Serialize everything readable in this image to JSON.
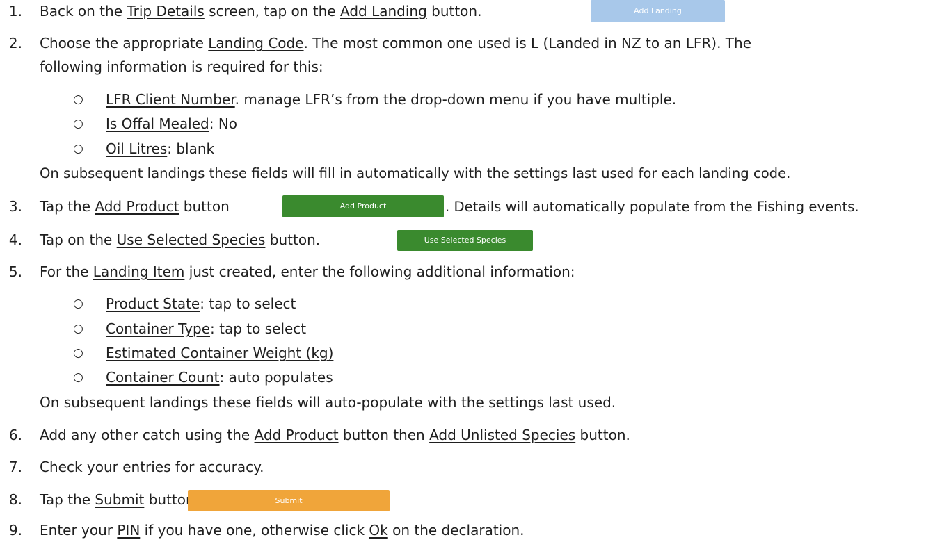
{
  "steps": [
    {
      "num": "1.",
      "parts": [
        "Back on the ",
        "Trip Details",
        " screen, tap on the ",
        "Add Landing",
        " button."
      ]
    },
    {
      "num": "2.",
      "parts": [
        "Choose the appropriate ",
        "Landing Code",
        ". The most common one used is L (Landed in NZ to an LFR). The"
      ],
      "cont": "following information is required for this:",
      "subitems": [
        {
          "link": "LFR Client Number",
          "rest": ". manage LFR’s from the drop-down menu if you have multiple."
        },
        {
          "link": "Is Offal Mealed",
          "rest": ": No"
        },
        {
          "link": "Oil Litres",
          "rest": ": blank"
        }
      ],
      "note": "On subsequent landings these fields will fill in automatically with the settings last used for each landing code."
    },
    {
      "num": "3.",
      "parts": [
        "Tap the ",
        "Add Product",
        " button",
        ". Details will automatically populate from the Fishing events."
      ]
    },
    {
      "num": "4.",
      "parts": [
        "Tap on the ",
        "Use Selected Species",
        " button."
      ]
    },
    {
      "num": "5.",
      "parts": [
        "For the ",
        "Landing Item",
        " just created, enter the following additional information:"
      ],
      "subitems": [
        {
          "link": "Product State",
          "rest": ": tap to select"
        },
        {
          "link": "Container Type",
          "rest": ": tap to select"
        },
        {
          "link": "Estimated Container Weight (kg)",
          "rest": ""
        },
        {
          "link": "Container Count",
          "rest": ": auto populates"
        }
      ],
      "note": "On subsequent landings these fields will auto-populate with the settings last used."
    },
    {
      "num": "6.",
      "parts": [
        "Add any other catch using the ",
        "Add Product",
        " button then ",
        "Add Unlisted Species",
        " button."
      ]
    },
    {
      "num": "7.",
      "parts": [
        "Check your entries for accuracy."
      ]
    },
    {
      "num": "8.",
      "parts": [
        "Tap the ",
        "Submit",
        " button."
      ]
    },
    {
      "num": "9.",
      "parts": [
        "Enter your ",
        "PIN",
        " if you have one, otherwise click ",
        "Ok",
        " on the declaration."
      ]
    }
  ],
  "bullet_glyph": "○",
  "buttons": {
    "add_landing": {
      "label": "Add Landing",
      "color": "#a8c8ea"
    },
    "add_product": {
      "label": "Add Product",
      "color": "#3a8a2e"
    },
    "use_selected_species": {
      "label": "Use Selected Species",
      "color": "#3a8a2e"
    },
    "submit": {
      "label": "Submit",
      "color": "#f0a53a"
    }
  }
}
